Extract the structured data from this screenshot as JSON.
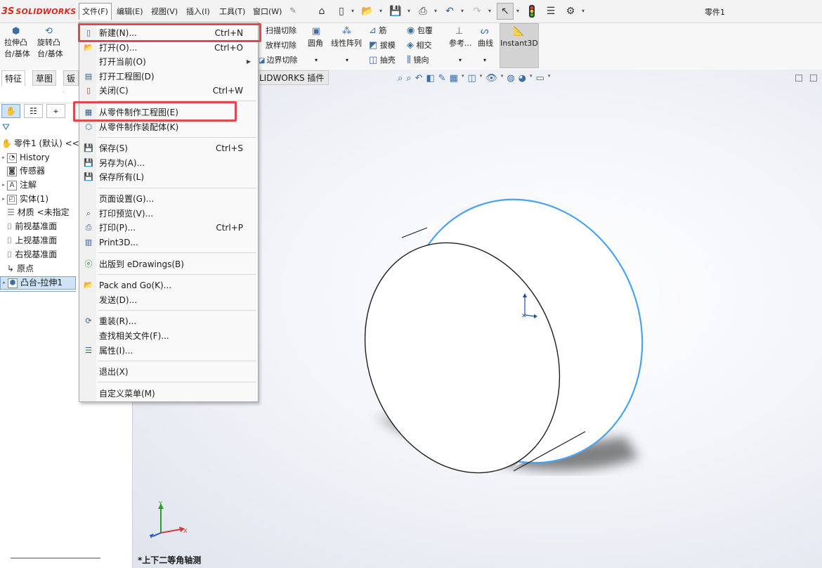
{
  "app": {
    "logo_ds": "3S",
    "logo_text": "SOLIDWORKS",
    "doc_title": "零件1"
  },
  "menubar": {
    "items": [
      "文件(F)",
      "编辑(E)",
      "视图(V)",
      "插入(I)",
      "工具(T)",
      "窗口(W)"
    ],
    "pin_icon": "pin-icon",
    "quick_access": [
      "home-icon",
      "new-doc-icon",
      "open-icon",
      "save-icon",
      "print-icon",
      "undo-icon",
      "redo-icon",
      "select-icon",
      "rebuild-icon",
      "file-props-icon",
      "options-icon"
    ]
  },
  "ribbon": {
    "extrude_boss": [
      "拉伸凸",
      "台/基体"
    ],
    "revolve_boss": [
      "旋转凸",
      "台/基体"
    ],
    "sweep_cut": "扫描切除",
    "loft_cut": "放样切除",
    "boundary_cut": "边界切除",
    "fillet": "圆角",
    "linear_pattern": "线性阵列",
    "rib": "筋",
    "wrap": "包覆",
    "draft": "拔模",
    "intersect": "相交",
    "shell": "抽壳",
    "mirror": "镜向",
    "reference": "参考...",
    "curves": "曲线",
    "instant3d": "Instant3D"
  },
  "panel_tabs": [
    "特征",
    "草图",
    "钣"
  ],
  "plugin_tab": "LIDWORKS 插件",
  "tree": {
    "root": "零件1 (默认) <<",
    "items": [
      "History",
      "传感器",
      "注解",
      "实体(1)",
      "材质 <未指定",
      "前视基准面",
      "上视基准面",
      "右视基准面",
      "原点",
      "凸台-拉伸1"
    ]
  },
  "file_menu": {
    "items": [
      {
        "label": "新建(N)...",
        "shortcut": "Ctrl+N"
      },
      {
        "label": "打开(O)...",
        "shortcut": "Ctrl+O"
      },
      {
        "label": "打开当前(O)",
        "shortcut": ""
      },
      {
        "label": "打开工程图(D)",
        "shortcut": ""
      },
      {
        "label": "关闭(C)",
        "shortcut": "Ctrl+W"
      },
      {
        "label": "从零件制作工程图(E)",
        "shortcut": ""
      },
      {
        "label": "从零件制作装配体(K)",
        "shortcut": ""
      },
      {
        "label": "保存(S)",
        "shortcut": "Ctrl+S"
      },
      {
        "label": "另存为(A)...",
        "shortcut": ""
      },
      {
        "label": "保存所有(L)",
        "shortcut": ""
      },
      {
        "label": "页面设置(G)...",
        "shortcut": ""
      },
      {
        "label": "打印预览(V)...",
        "shortcut": ""
      },
      {
        "label": "打印(P)...",
        "shortcut": "Ctrl+P"
      },
      {
        "label": "Print3D...",
        "shortcut": ""
      },
      {
        "label": "出版到 eDrawings(B)",
        "shortcut": ""
      },
      {
        "label": "Pack and Go(K)...",
        "shortcut": ""
      },
      {
        "label": "发送(D)...",
        "shortcut": ""
      },
      {
        "label": "重装(R)...",
        "shortcut": ""
      },
      {
        "label": "查找相关文件(F)...",
        "shortcut": ""
      },
      {
        "label": "属性(I)...",
        "shortcut": ""
      },
      {
        "label": "退出(X)",
        "shortcut": ""
      },
      {
        "label": "自定义菜单(M)",
        "shortcut": ""
      }
    ]
  },
  "triad": {
    "x": "X",
    "y": "Y"
  },
  "status": {
    "view_name": "*上下二等角轴测"
  },
  "colors": {
    "highlight": "#e0484d",
    "edge_highlight": "#4aa3f0",
    "brand": "#d52b1e"
  }
}
